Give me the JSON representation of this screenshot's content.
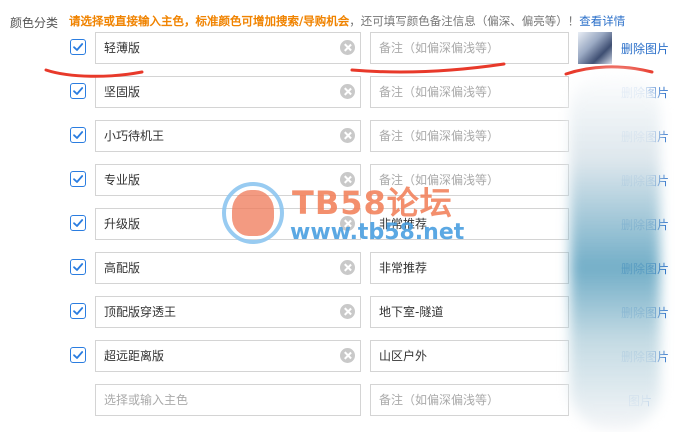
{
  "section_label": "颜色分类",
  "hint": {
    "highlight": "请选择或直接输入主色，标准颜色可增加搜索/导购机会",
    "normal": "，还可填写颜色备注信息（偏深、偏亮等）！",
    "link": "查看详情"
  },
  "note_placeholder": "备注（如偏深偏浅等）",
  "color_placeholder": "选择或输入主色",
  "rows": [
    {
      "checked": true,
      "color": "轻薄版",
      "note": "",
      "thumb": true,
      "action": "删除图片"
    },
    {
      "checked": true,
      "color": "坚固版",
      "note": "",
      "thumb": false,
      "action": "删除图片"
    },
    {
      "checked": true,
      "color": "小巧待机王",
      "note": "",
      "thumb": false,
      "action": "删除图片"
    },
    {
      "checked": true,
      "color": "专业版",
      "note": "",
      "thumb": false,
      "action": "删除图片"
    },
    {
      "checked": true,
      "color": "升级版",
      "note": "非常推荐",
      "thumb": false,
      "action": "删除图片"
    },
    {
      "checked": true,
      "color": "高配版",
      "note": "非常推荐",
      "thumb": false,
      "action": "删除图片"
    },
    {
      "checked": true,
      "color": "顶配版穿透王",
      "note": "地下室-隧道",
      "thumb": false,
      "action": "删除图片"
    },
    {
      "checked": true,
      "color": "超远距离版",
      "note": "山区户外",
      "thumb": false,
      "action": "删除图片"
    },
    {
      "checked": false,
      "color": "",
      "note": "",
      "thumb": false,
      "action": "图片"
    }
  ],
  "watermark": {
    "title": "TB58论坛",
    "url": "www.tb58.net"
  },
  "colors": {
    "accent_orange": "#f08300",
    "link_blue": "#2a6fc9",
    "check_blue": "#2b7de0",
    "annotation_red": "#e8392a"
  }
}
